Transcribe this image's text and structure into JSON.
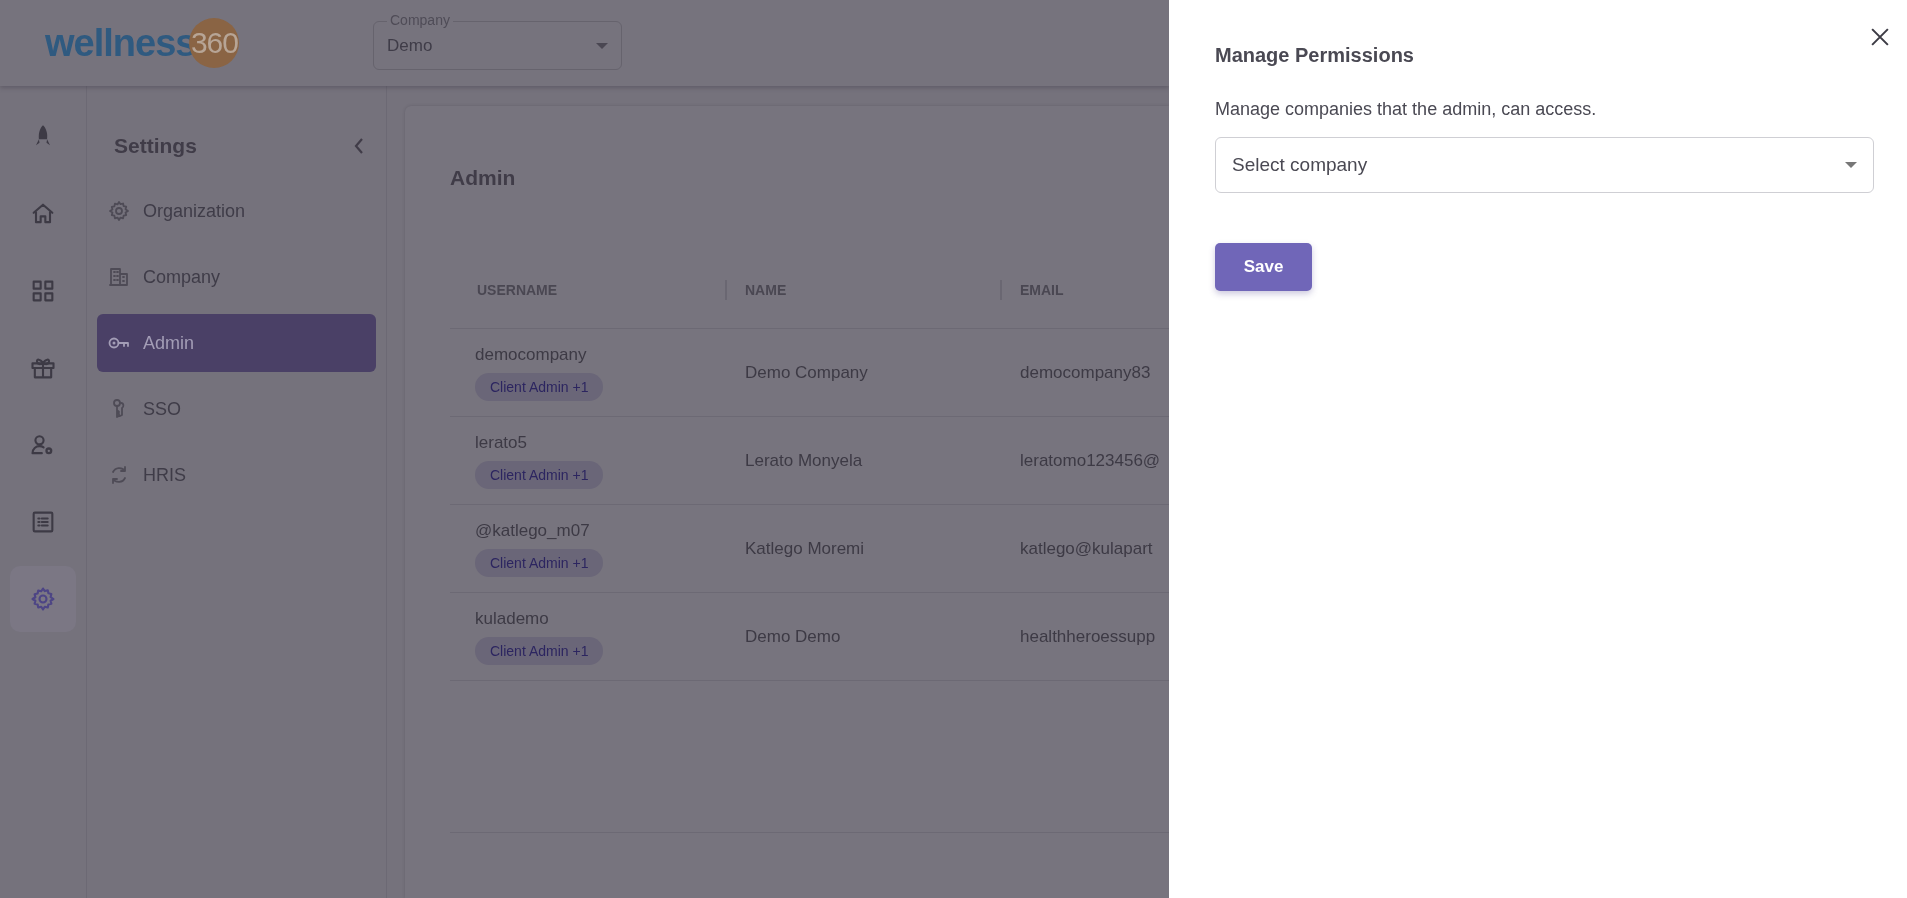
{
  "header": {
    "logo": {
      "word": "wellness",
      "badge": "360"
    },
    "company_field": {
      "label": "Company",
      "value": "Demo"
    }
  },
  "rail": [
    {
      "kind": "rocket",
      "selected": false
    },
    {
      "kind": "home",
      "selected": false
    },
    {
      "kind": "grid",
      "selected": false
    },
    {
      "kind": "gift",
      "selected": false
    },
    {
      "kind": "user-gear",
      "selected": false
    },
    {
      "kind": "list",
      "selected": false
    },
    {
      "kind": "gear",
      "selected": true
    }
  ],
  "settings": {
    "title": "Settings",
    "items": [
      {
        "kind": "gear",
        "label": "Organization",
        "selected": false
      },
      {
        "kind": "building",
        "label": "Company",
        "selected": false
      },
      {
        "kind": "key",
        "label": "Admin",
        "selected": true
      },
      {
        "kind": "keys",
        "label": "SSO",
        "selected": false
      },
      {
        "kind": "sync",
        "label": "HRIS",
        "selected": false
      }
    ]
  },
  "page": {
    "title": "Admin",
    "table": {
      "columns": [
        "USERNAME",
        "NAME",
        "EMAIL"
      ],
      "rows": [
        {
          "username": "democompany",
          "role": "Client Admin +1",
          "name": "Demo Company",
          "email": "democompany83"
        },
        {
          "username": "lerato5",
          "role": "Client Admin +1",
          "name": "Lerato Monyela",
          "email": "leratomo123456@"
        },
        {
          "username": "@katlego_m07",
          "role": "Client Admin +1",
          "name": "Katlego Moremi",
          "email": "katlego@kulapart"
        },
        {
          "username": "kulademo",
          "role": "Client Admin +1",
          "name": "Demo Demo",
          "email": "healthheroessupp"
        }
      ]
    }
  },
  "drawer": {
    "title": "Manage Permissions",
    "description": "Manage companies that the admin, can access.",
    "company_select": {
      "placeholder": "Select company"
    },
    "save_button": "Save"
  }
}
